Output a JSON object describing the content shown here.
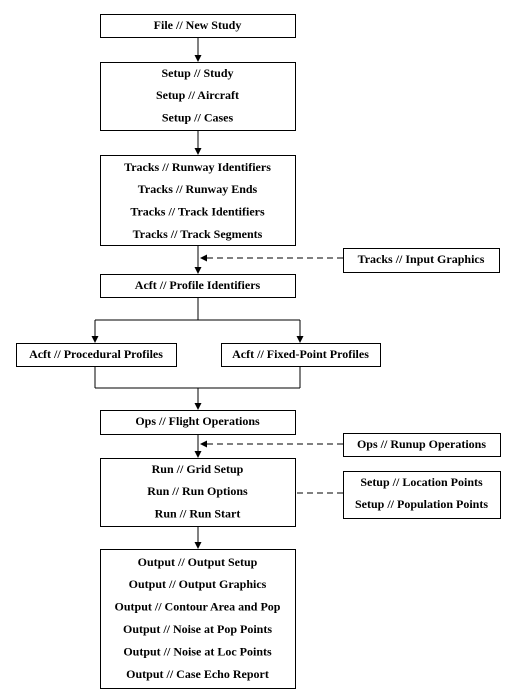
{
  "boxes": {
    "file": [
      "File // New Study"
    ],
    "setup": [
      "Setup // Study",
      "Setup // Aircraft",
      "Setup // Cases"
    ],
    "tracks": [
      "Tracks // Runway Identifiers",
      "Tracks // Runway Ends",
      "Tracks // Track Identifiers",
      "Tracks // Track Segments"
    ],
    "tracks_input": [
      "Tracks // Input Graphics"
    ],
    "acft_profile": [
      "Acft // Profile Identifiers"
    ],
    "acft_procedural": [
      "Acft // Procedural Profiles"
    ],
    "acft_fixed": [
      "Acft // Fixed-Point Profiles"
    ],
    "ops_flight": [
      "Ops // Flight Operations"
    ],
    "ops_runup": [
      "Ops // Runup Operations"
    ],
    "run": [
      "Run // Grid Setup",
      "Run // Run Options",
      "Run // Run Start"
    ],
    "setup_points": [
      "Setup // Location Points",
      "Setup // Population Points"
    ],
    "output": [
      "Output // Output Setup",
      "Output // Output Graphics",
      "Output // Contour Area and Pop",
      "Output // Noise at Pop Points",
      "Output // Noise at Loc Points",
      "Output // Case Echo Report"
    ]
  }
}
